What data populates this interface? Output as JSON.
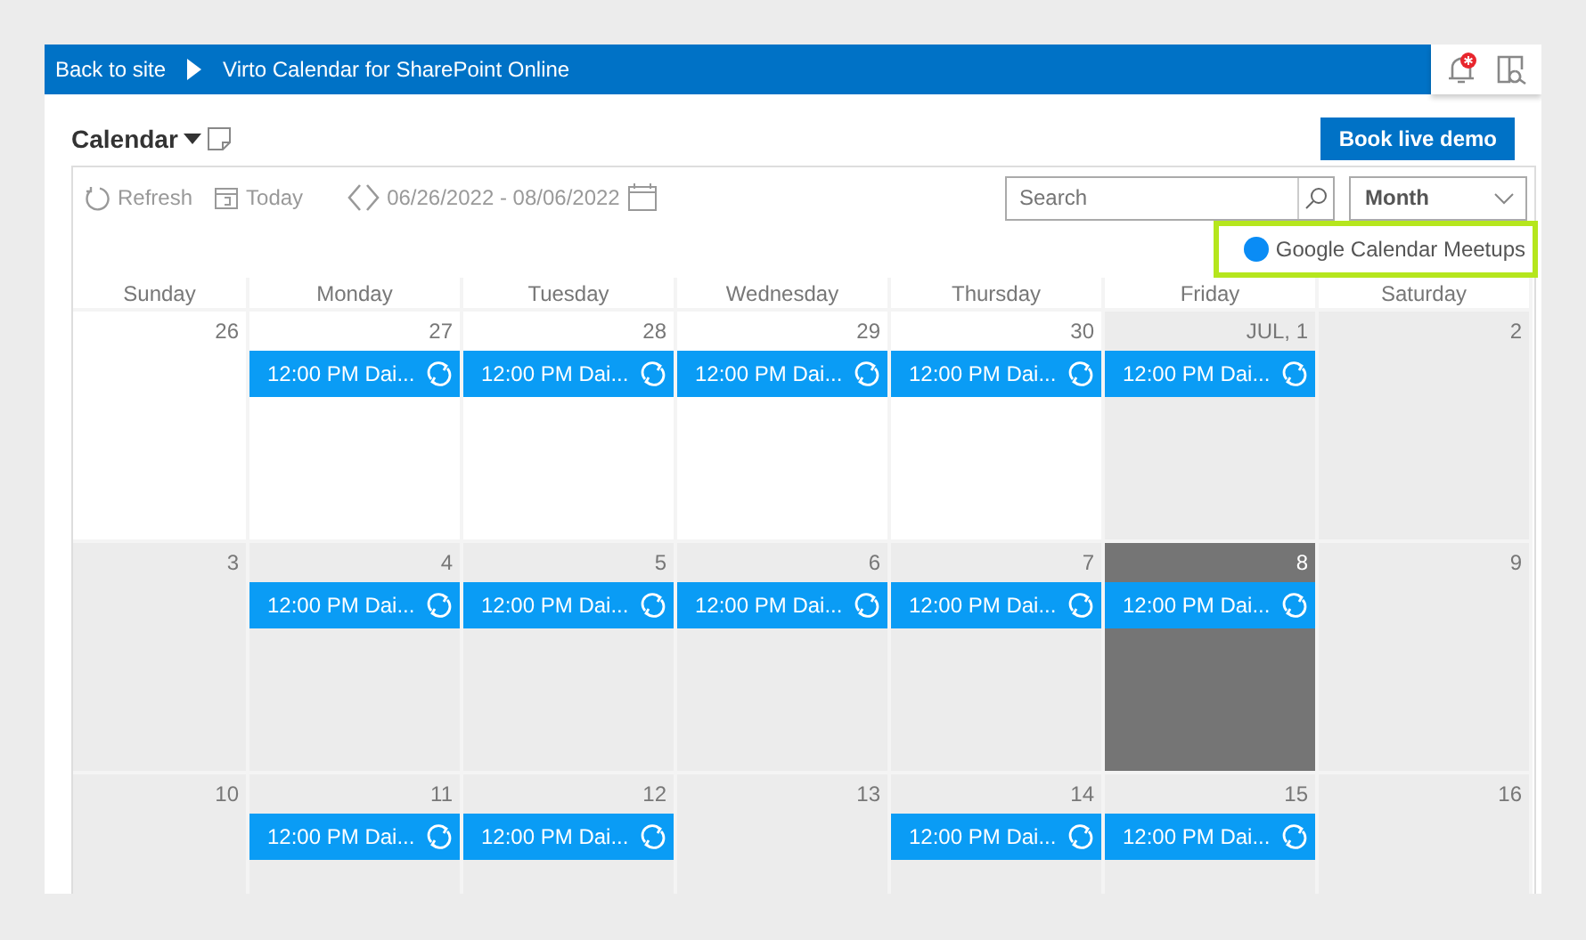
{
  "topbar": {
    "back_link": "Back to site",
    "title": "Virto Calendar for SharePoint Online"
  },
  "header": {
    "title": "Calendar",
    "book_button": "Book live demo"
  },
  "toolbar": {
    "refresh": "Refresh",
    "today": "Today",
    "date_range": "06/26/2022 - 08/06/2022",
    "search": {
      "placeholder": "Search"
    },
    "view": "Month"
  },
  "legend": [
    {
      "label": "Google Calendar Meetups",
      "color": "#0a8cf5"
    }
  ],
  "weekdays": [
    "Sunday",
    "Monday",
    "Tuesday",
    "Wednesday",
    "Thursday",
    "Friday",
    "Saturday"
  ],
  "weeks": [
    [
      {
        "day": "26",
        "shaded": false,
        "today": false
      },
      {
        "day": "27",
        "shaded": false,
        "today": false,
        "events": [
          {
            "text": "12:00 PM Dai...",
            "recurring": true
          }
        ]
      },
      {
        "day": "28",
        "shaded": false,
        "today": false,
        "events": [
          {
            "text": "12:00 PM Dai...",
            "recurring": true
          }
        ]
      },
      {
        "day": "29",
        "shaded": false,
        "today": false,
        "events": [
          {
            "text": "12:00 PM Dai...",
            "recurring": true
          }
        ]
      },
      {
        "day": "30",
        "shaded": false,
        "today": false,
        "events": [
          {
            "text": "12:00 PM Dai...",
            "recurring": true
          }
        ]
      },
      {
        "day": "JUL, 1",
        "shaded": true,
        "today": false,
        "events": [
          {
            "text": "12:00 PM Dai...",
            "recurring": true
          }
        ]
      },
      {
        "day": "2",
        "shaded": true,
        "today": false
      }
    ],
    [
      {
        "day": "3",
        "shaded": true,
        "today": false
      },
      {
        "day": "4",
        "shaded": true,
        "today": false,
        "events": [
          {
            "text": "12:00 PM Dai...",
            "recurring": true
          }
        ]
      },
      {
        "day": "5",
        "shaded": true,
        "today": false,
        "events": [
          {
            "text": "12:00 PM Dai...",
            "recurring": true
          }
        ]
      },
      {
        "day": "6",
        "shaded": true,
        "today": false,
        "events": [
          {
            "text": "12:00 PM Dai...",
            "recurring": true
          }
        ]
      },
      {
        "day": "7",
        "shaded": true,
        "today": false,
        "events": [
          {
            "text": "12:00 PM Dai...",
            "recurring": true
          }
        ]
      },
      {
        "day": "8",
        "shaded": true,
        "today": true,
        "events": [
          {
            "text": "12:00 PM Dai...",
            "recurring": true
          }
        ]
      },
      {
        "day": "9",
        "shaded": true,
        "today": false
      }
    ],
    [
      {
        "day": "10",
        "shaded": true,
        "today": false
      },
      {
        "day": "11",
        "shaded": true,
        "today": false,
        "events": [
          {
            "text": "12:00 PM Dai...",
            "recurring": true
          }
        ]
      },
      {
        "day": "12",
        "shaded": true,
        "today": false,
        "events": [
          {
            "text": "12:00 PM Dai...",
            "recurring": true
          }
        ]
      },
      {
        "day": "13",
        "shaded": true,
        "today": false
      },
      {
        "day": "14",
        "shaded": true,
        "today": false,
        "events": [
          {
            "text": "12:00 PM Dai...",
            "recurring": true
          }
        ]
      },
      {
        "day": "15",
        "shaded": true,
        "today": false,
        "events": [
          {
            "text": "12:00 PM Dai...",
            "recurring": true
          }
        ]
      },
      {
        "day": "16",
        "shaded": true,
        "today": false
      }
    ]
  ]
}
